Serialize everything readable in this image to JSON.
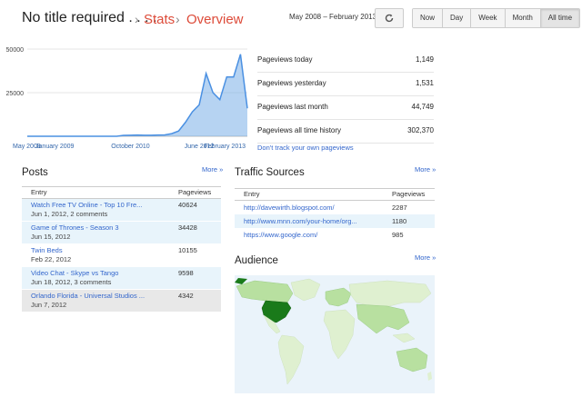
{
  "header": {
    "blog_title": "No title required . . . .",
    "breadcrumb_stats": "Stats",
    "breadcrumb_sep": "›",
    "breadcrumb_overview": "Overview",
    "date_range": "May 2008 – February 2013",
    "ranges": [
      "Now",
      "Day",
      "Week",
      "Month",
      "All time"
    ],
    "active_range": "All time"
  },
  "chart_data": {
    "type": "area",
    "x": [
      "May 2008",
      "Jul 2008",
      "Sep 2008",
      "Nov 2008",
      "Jan 2009",
      "Mar 2009",
      "May 2009",
      "Jul 2009",
      "Sep 2009",
      "Nov 2009",
      "Jan 2010",
      "Mar 2010",
      "May 2010",
      "Jul 2010",
      "Sep 2010",
      "Oct 2010",
      "Dec 2010",
      "Feb 2011",
      "Apr 2011",
      "Jun 2011",
      "Aug 2011",
      "Oct 2011",
      "Dec 2011",
      "Feb 2012",
      "Apr 2012",
      "Jun 2012",
      "Aug 2012",
      "Sep 2012",
      "Oct 2012",
      "Nov 2012",
      "Dec 2012",
      "Jan 2013",
      "Feb 2013"
    ],
    "values": [
      0,
      0,
      0,
      0,
      0,
      0,
      0,
      0,
      0,
      0,
      0,
      0,
      0,
      0,
      500,
      600,
      700,
      600,
      600,
      700,
      800,
      1500,
      3000,
      8000,
      14000,
      18000,
      36000,
      25000,
      21000,
      34000,
      34000,
      47000,
      16000
    ],
    "x_tick_labels": [
      "May 2008",
      "January 2009",
      "October 2010",
      "June 2012",
      "February 2013"
    ],
    "y_tick_labels": [
      "50000",
      "25000"
    ],
    "ylim": [
      0,
      50000
    ],
    "color": "#7aaee8",
    "line_color": "#4a90e2",
    "grid": true
  },
  "stats": [
    {
      "label": "Pageviews today",
      "value": "1,149"
    },
    {
      "label": "Pageviews yesterday",
      "value": "1,531"
    },
    {
      "label": "Pageviews last month",
      "value": "44,749"
    },
    {
      "label": "Pageviews all time history",
      "value": "302,370"
    }
  ],
  "dont_track": "Don't track your own pageviews",
  "posts": {
    "title": "Posts",
    "more": "More »",
    "col_entry": "Entry",
    "col_pageviews": "Pageviews",
    "rows": [
      {
        "title": "Watch Free TV Online - Top 10 Fre...",
        "meta": "Jun 1, 2012, 2 comments",
        "views": "40624"
      },
      {
        "title": "Game of Thrones - Season 3",
        "meta": "Jun 15, 2012",
        "views": "34428"
      },
      {
        "title": "Twin Beds",
        "meta": "Feb 22, 2012",
        "views": "10155"
      },
      {
        "title": "Video Chat - Skype vs Tango",
        "meta": "Jun 18, 2012, 3 comments",
        "views": "9598"
      },
      {
        "title": "Orlando Florida - Universal Studios ...",
        "meta": "Jun 7, 2012",
        "views": "4342"
      }
    ]
  },
  "traffic": {
    "title": "Traffic Sources",
    "more": "More »",
    "col_entry": "Entry",
    "col_pageviews": "Pageviews",
    "rows": [
      {
        "url": "http://davewirth.blogspot.com/",
        "views": "2287"
      },
      {
        "url": "http://www.mnn.com/your-home/org...",
        "views": "1180"
      },
      {
        "url": "https://www.google.com/",
        "views": "985"
      }
    ]
  },
  "audience": {
    "title": "Audience",
    "more": "More »",
    "colors": {
      "ocean": "#eaf3fa",
      "land_low": "#dff0d0",
      "land_mid": "#b8e0a0",
      "land_high": "#1a7a1a"
    }
  }
}
